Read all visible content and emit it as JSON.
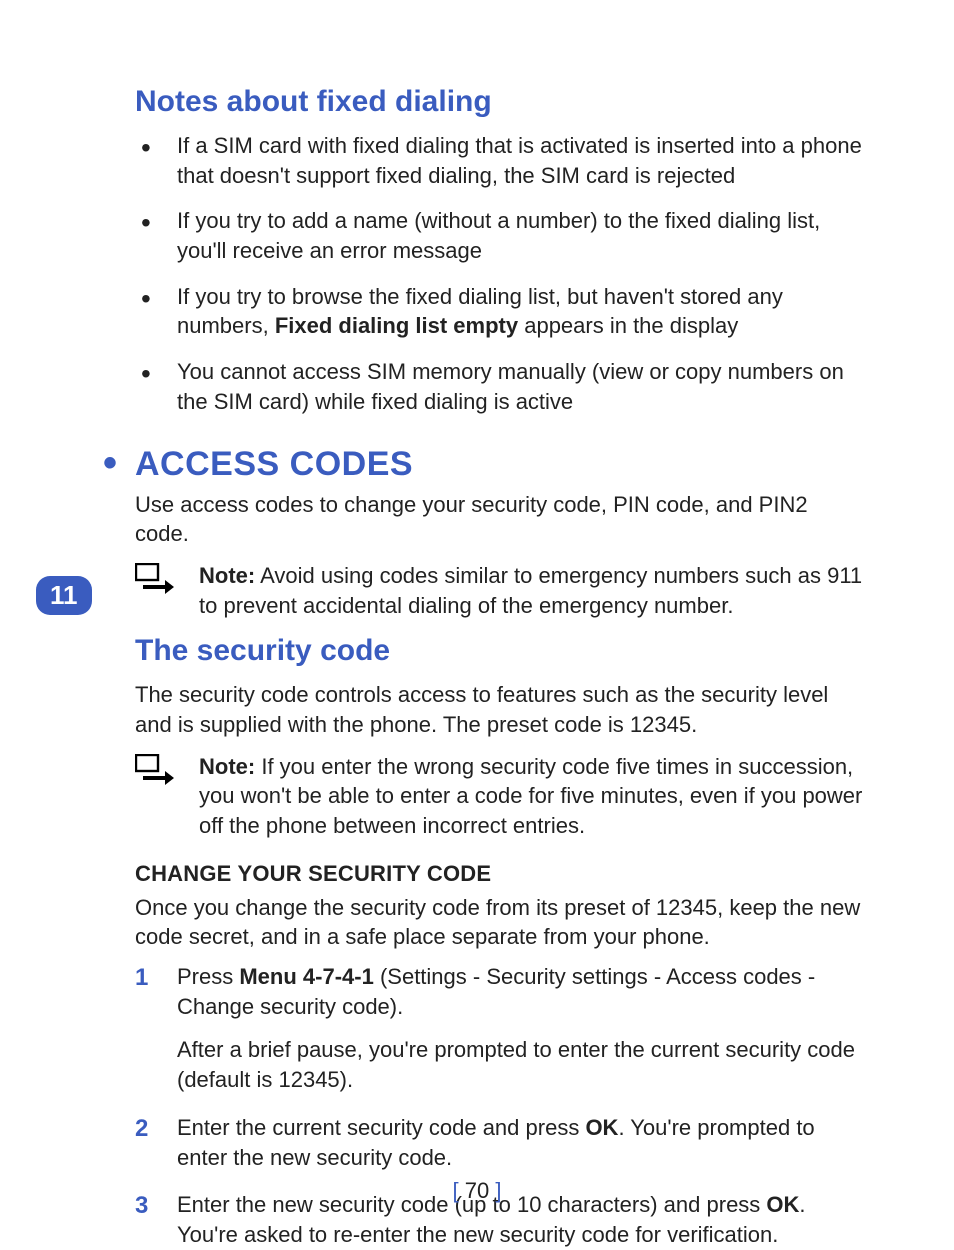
{
  "tab_number": "11",
  "heading_notes": "Notes about fixed dialing",
  "bullets": [
    "If a SIM card with fixed dialing that is activated is inserted into a phone that doesn't support fixed dialing, the SIM card is rejected",
    "If you try to add a name (without a number) to the fixed dialing list, you'll receive an error message",
    "",
    "You cannot access SIM memory manually (view or copy numbers on the SIM card) while fixed dialing is active"
  ],
  "bullet3": {
    "pre": "If you try to browse the fixed dialing list, but haven't stored any numbers, ",
    "bold": "Fixed dialing list empty",
    "post": " appears in the display"
  },
  "heading_access": "Access codes",
  "access_intro": "Use access codes to change your security code, PIN code, and PIN2 code.",
  "note_label": "Note:",
  "note1_text": " Avoid using codes similar to emergency numbers such as 911 to prevent accidental dialing of the emergency number.",
  "heading_security": "The security code",
  "security_intro": "The security code controls access to features such as the security level and is supplied with the phone. The preset code is 12345.",
  "note2_text": " If you enter the wrong security code five times in succession, you won't be able to enter a code for five minutes, even if you power off the phone between incorrect entries.",
  "heading_change": "Change your security code",
  "change_intro": "Once you change the security code from its preset of 12345, keep the new code secret, and in a safe place separate from your phone.",
  "steps": {
    "s1": {
      "num": "1",
      "pre": "Press ",
      "bold": "Menu 4-7-4-1",
      "post": " (Settings - Security settings - Access codes - Change security code).",
      "sub": "After a brief pause, you're prompted to enter the current security code (default is 12345)."
    },
    "s2": {
      "num": "2",
      "pre": "Enter the current security code and press ",
      "bold": "OK",
      "post": ". You're prompted to enter the new security code."
    },
    "s3": {
      "num": "3",
      "pre": "Enter the new security code (up to 10 characters) and press ",
      "bold": "OK",
      "post": ". You're asked to re-enter the new security code for verification."
    }
  },
  "footer": {
    "left": "[ ",
    "num": "70",
    "right": " ]"
  }
}
